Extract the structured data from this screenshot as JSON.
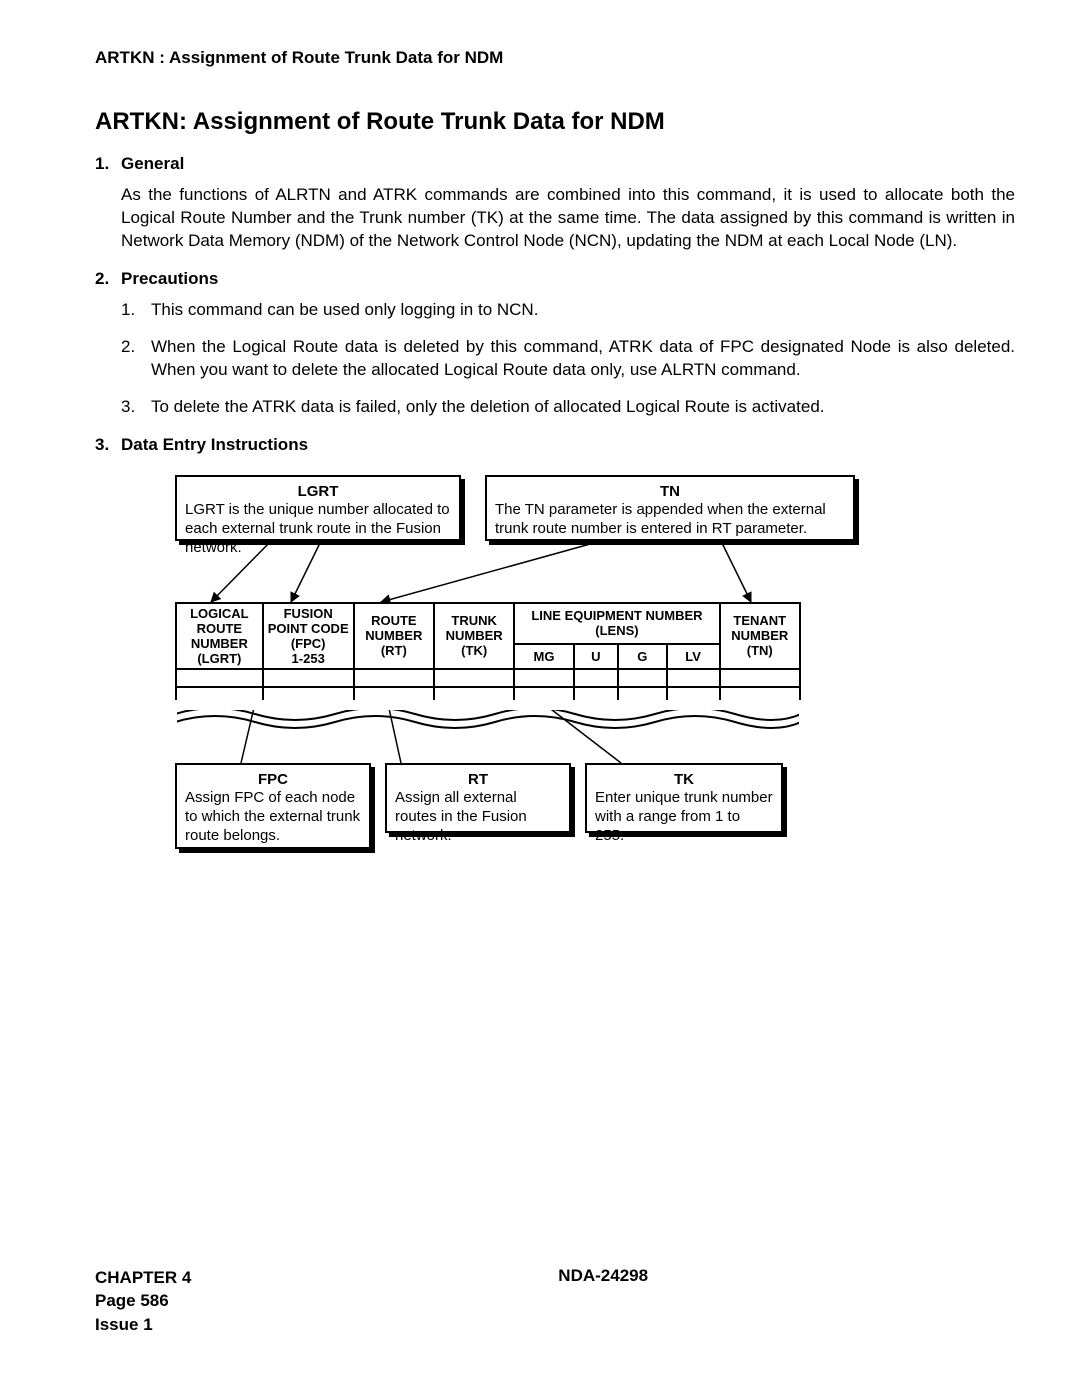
{
  "running_head": "ARTKN : Assignment of Route Trunk Data for NDM",
  "title": "ARTKN: Assignment of Route Trunk Data for NDM",
  "sections": {
    "general": {
      "num": "1.",
      "head": "General",
      "body": "As the functions of ALRTN and ATRK commands are combined into this command, it is used to allocate both the Logical Route Number and the Trunk number (TK) at the same time. The data assigned by this command is written in Network Data Memory (NDM) of the Network Control Node (NCN), updating the NDM at each Local Node (LN)."
    },
    "precautions": {
      "num": "2.",
      "head": "Precautions",
      "items": [
        {
          "n": "1.",
          "t": "This command can be used only logging in to NCN."
        },
        {
          "n": "2.",
          "t": "When the Logical Route data is deleted by this command, ATRK data of FPC designated Node is also deleted. When you want to delete the allocated Logical Route data only, use ALRTN command."
        },
        {
          "n": "3.",
          "t": "To delete the ATRK data is failed, only the deletion of allocated Logical Route is activated."
        }
      ]
    },
    "dei": {
      "num": "3.",
      "head": "Data Entry Instructions"
    }
  },
  "callouts": {
    "lgrt": {
      "title": "LGRT",
      "text": "LGRT is the unique number allocated to each external trunk route in the Fusion network."
    },
    "tn": {
      "title": "TN",
      "text": "The TN parameter is appended when the external trunk route number is entered in RT parameter."
    },
    "fpc": {
      "title": "FPC",
      "text": "Assign FPC of each node to which the external trunk route belongs."
    },
    "rt": {
      "title": "RT",
      "text": "Assign all external routes in the Fusion network."
    },
    "tk": {
      "title": "TK",
      "text": "Enter unique trunk number with a range from 1 to 255."
    }
  },
  "table": {
    "headers": {
      "lgrt": [
        "LOGICAL",
        "ROUTE",
        "NUMBER",
        "(LGRT)"
      ],
      "fpc": [
        "FUSION",
        "POINT CODE",
        "(FPC)",
        "1-253"
      ],
      "rt": [
        "ROUTE",
        "NUMBER",
        "(RT)"
      ],
      "tk": [
        "TRUNK",
        "NUMBER",
        "(TK)"
      ],
      "lens_top": "LINE EQUIPMENT NUMBER",
      "lens_sub": "(LENS)",
      "mg": "MG",
      "u": "U",
      "g": "G",
      "lv": "LV",
      "tn": [
        "TENANT",
        "NUMBER",
        "(TN)"
      ]
    }
  },
  "footer": {
    "chapter": "CHAPTER 4",
    "page": "Page 586",
    "issue": "Issue 1",
    "doc": "NDA-24298"
  },
  "chart_data": {
    "type": "table",
    "columns": [
      "LOGICAL ROUTE NUMBER (LGRT)",
      "FUSION POINT CODE (FPC) 1-253",
      "ROUTE NUMBER (RT)",
      "TRUNK NUMBER (TK)",
      "MG",
      "U",
      "G",
      "LV",
      "TENANT NUMBER (TN)"
    ],
    "column_group": {
      "LINE EQUIPMENT NUMBER (LENS)": [
        "MG",
        "U",
        "G",
        "LV"
      ]
    },
    "rows": [],
    "callouts": [
      {
        "param": "LGRT",
        "text": "LGRT is the unique number allocated to each external trunk route in the Fusion network."
      },
      {
        "param": "TN",
        "text": "The TN parameter is appended when the external trunk route number is entered in RT parameter."
      },
      {
        "param": "FPC",
        "text": "Assign FPC of each node to which the external trunk route belongs."
      },
      {
        "param": "RT",
        "text": "Assign all external routes in the Fusion network."
      },
      {
        "param": "TK",
        "text": "Enter unique trunk number with a range from 1 to 255."
      }
    ]
  }
}
